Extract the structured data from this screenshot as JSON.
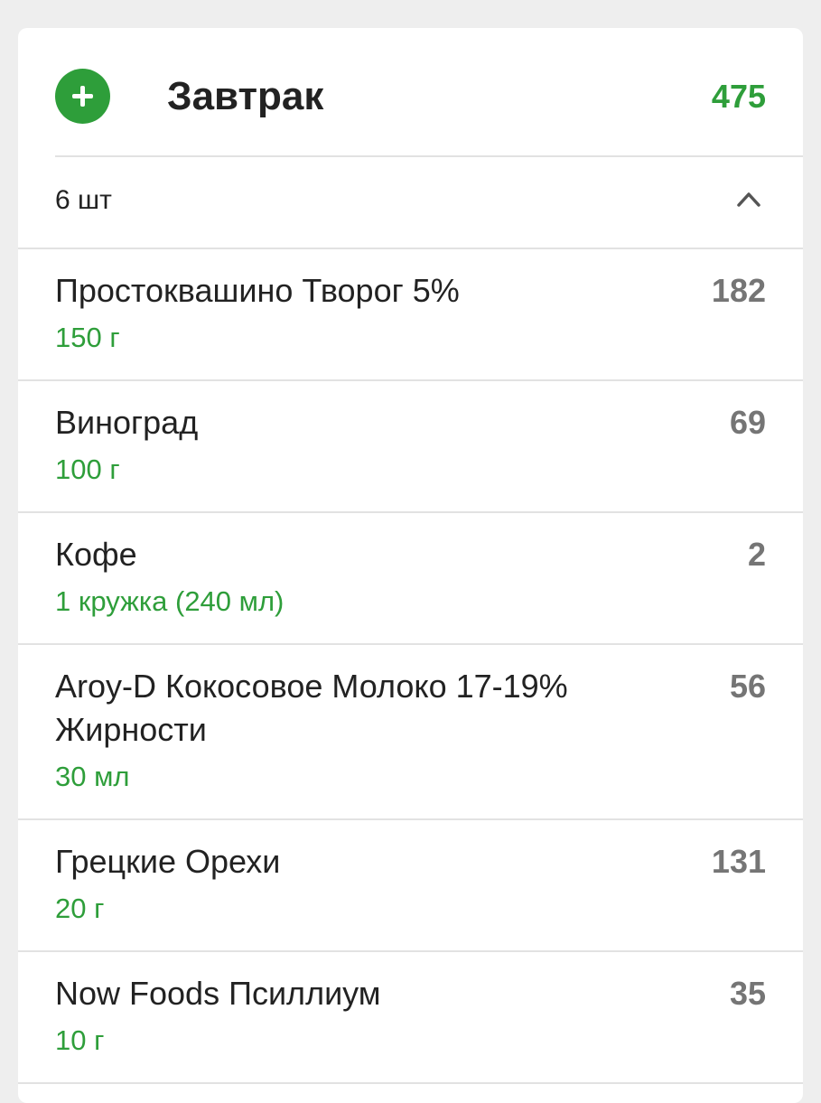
{
  "meal": {
    "title": "Завтрак",
    "total": "475",
    "count_label": "6 шт"
  },
  "items": [
    {
      "name": "Простоквашино Творог 5%",
      "amount": "150 г",
      "calories": "182"
    },
    {
      "name": "Виноград",
      "amount": "100 г",
      "calories": "69"
    },
    {
      "name": "Кофе",
      "amount": "1 кружка (240 мл)",
      "calories": "2"
    },
    {
      "name": "Aroy-D Кокосовое Молоко 17-19% Жирности",
      "amount": "30 мл",
      "calories": "56"
    },
    {
      "name": "Грецкие Орехи",
      "amount": "20 г",
      "calories": "131"
    },
    {
      "name": "Now Foods Псиллиум",
      "amount": "10 г",
      "calories": "35"
    }
  ],
  "colors": {
    "accent": "#2e9e3a",
    "calories_text": "#757575",
    "background": "#eeeeee"
  },
  "icons": {
    "add": "plus-icon",
    "collapse": "chevron-up-icon"
  }
}
